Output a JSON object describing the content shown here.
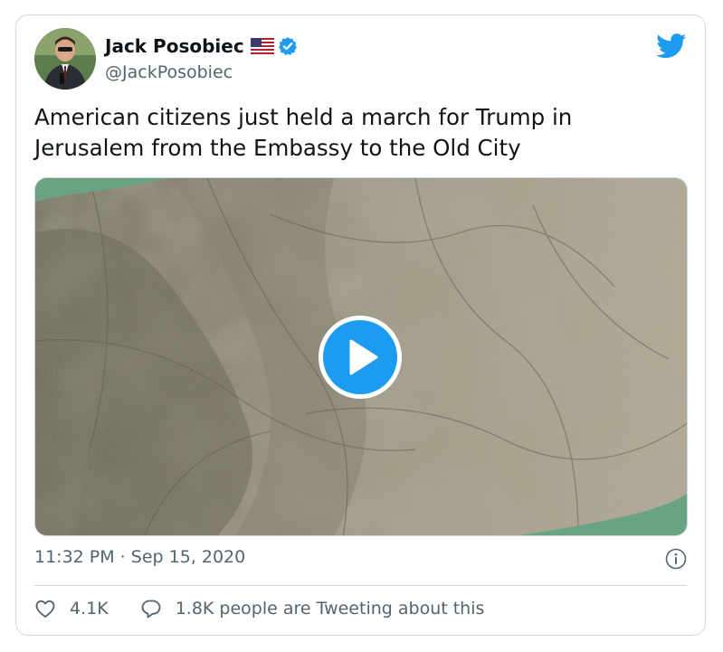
{
  "author": {
    "display_name": "Jack Posobiec",
    "handle": "@JackPosobiec",
    "verified": true,
    "flag_icon": "us-flag-icon"
  },
  "tweet": {
    "text_line1": "American citizens just held a march for Trump in",
    "text_line2": "Jerusalem from the Embassy to the Old City",
    "timestamp": "11:32 PM · Sep 15, 2020"
  },
  "media": {
    "type": "video",
    "play_icon": "play-icon"
  },
  "actions": {
    "like_count": "4.1K",
    "reply_text": "1.8K people are Tweeting about this"
  },
  "colors": {
    "twitter_blue": "#1d9bf0",
    "text_primary": "#0f1419",
    "text_secondary": "#536471",
    "border": "#cfd9de",
    "like_red": "#e0245e"
  }
}
